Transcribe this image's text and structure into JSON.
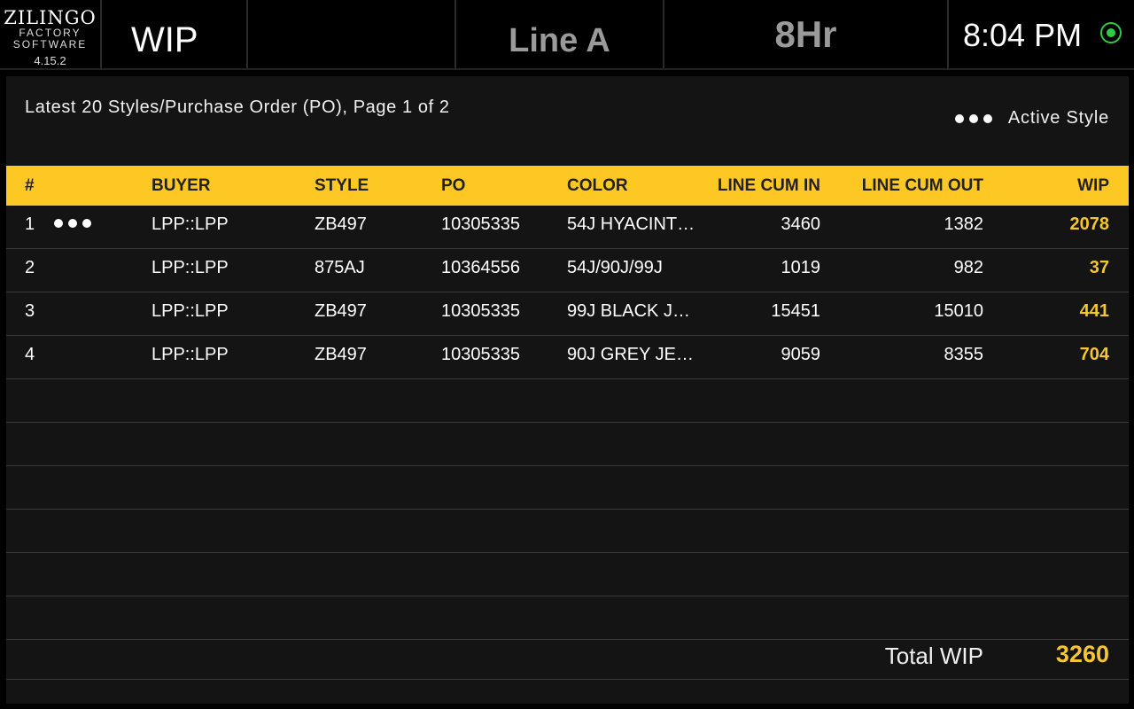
{
  "header": {
    "brand_line1": "ZILINGO",
    "brand_line2": "FACTORY",
    "brand_line3": "SOFTWARE",
    "version": "4.15.2",
    "page_title": "WIP",
    "line": "Line A",
    "shift": "8Hr",
    "time": "8:04 PM",
    "status_icon": "radio-online-icon",
    "status_color": "#2ecc40"
  },
  "panel": {
    "subtitle": "Latest 20 Styles/Purchase Order (PO), Page 1 of 2",
    "legend_label": "Active Style",
    "legend_icon": "active-style-dots-icon"
  },
  "table": {
    "columns": [
      "#",
      "BUYER",
      "STYLE",
      "PO",
      "COLOR",
      "LINE CUM IN",
      "LINE CUM OUT",
      "WIP"
    ],
    "rows": [
      {
        "idx": "1",
        "active": true,
        "buyer": "LPP::LPP",
        "style": "ZB497",
        "po": "10305335",
        "color": "54J HYACINT…",
        "cum_in": "3460",
        "cum_out": "1382",
        "wip": "2078"
      },
      {
        "idx": "2",
        "active": false,
        "buyer": "LPP::LPP",
        "style": "875AJ",
        "po": "10364556",
        "color": "54J/90J/99J",
        "cum_in": "1019",
        "cum_out": "982",
        "wip": "37"
      },
      {
        "idx": "3",
        "active": false,
        "buyer": "LPP::LPP",
        "style": "ZB497",
        "po": "10305335",
        "color": "99J BLACK JE…",
        "cum_in": "15451",
        "cum_out": "15010",
        "wip": "441"
      },
      {
        "idx": "4",
        "active": false,
        "buyer": "LPP::LPP",
        "style": "ZB497",
        "po": "10305335",
        "color": "90J GREY JE…",
        "cum_in": "9059",
        "cum_out": "8355",
        "wip": "704"
      }
    ],
    "empty_row_count": 6
  },
  "total": {
    "label": "Total WIP",
    "value": "3260"
  },
  "colors": {
    "accent": "#fec824",
    "wip_value": "#f5c532",
    "background": "#141414"
  }
}
